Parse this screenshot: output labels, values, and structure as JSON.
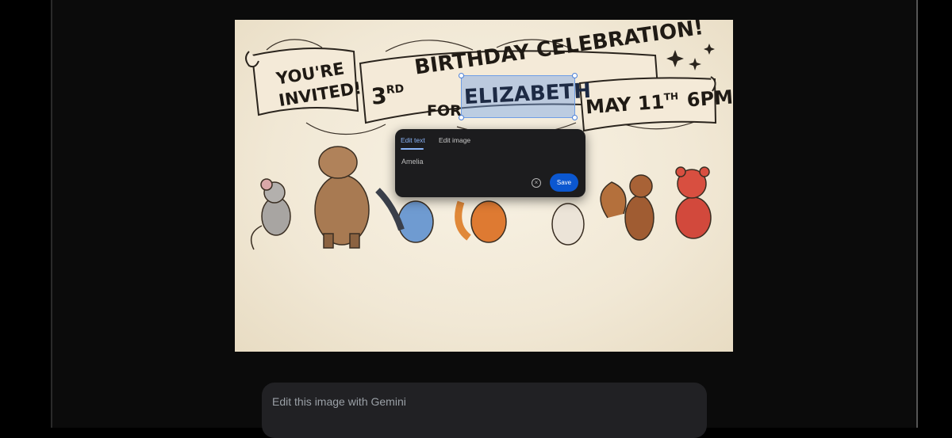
{
  "invitation": {
    "banner_left_line1": "YOU'RE",
    "banner_left_line2": "INVITED!",
    "ordinal_number": "3",
    "ordinal_suffix": "RD",
    "headline": "BIRTHDAY CELEBRATION!",
    "for_label": "FOR",
    "name": "ELIZABETH",
    "date": "MAY 11",
    "date_suffix": "TH",
    "time": "6PM"
  },
  "edit_popover": {
    "tabs": [
      {
        "label": "Edit text",
        "active": true
      },
      {
        "label": "Edit image",
        "active": false
      }
    ],
    "input_value": "Amelia",
    "clear_icon": "clear-circle-icon",
    "save_label": "Save"
  },
  "gemini_prompt": {
    "placeholder": "Edit this image with Gemini"
  },
  "colors": {
    "accent": "#8ab4f8",
    "save_button": "#0b57d0",
    "selection": "#78a5e6"
  }
}
